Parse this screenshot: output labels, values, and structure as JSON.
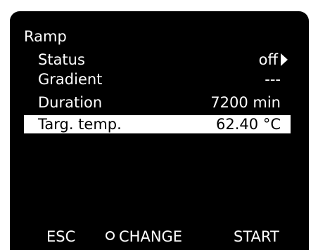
{
  "menu": {
    "title": "Ramp"
  },
  "rows": [
    {
      "label": "Status",
      "value": "off"
    },
    {
      "label": "Gradient",
      "value": "---"
    },
    {
      "label": "Duration",
      "value": "7200 min"
    },
    {
      "label": "Targ. temp.",
      "value": "62.40 °C"
    }
  ],
  "softkeys": {
    "esc": "ESC",
    "change": "CHANGE",
    "start": "START"
  },
  "icons": {
    "status_arrow": "play-arrow-icon",
    "change_marker": "circle-icon"
  },
  "colors": {
    "screen_bg": "#000000",
    "text": "#ffffff",
    "highlight_bg": "#ffffff",
    "highlight_text": "#000000"
  }
}
